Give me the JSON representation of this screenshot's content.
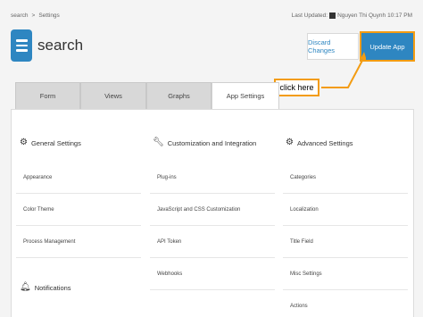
{
  "breadcrumb": {
    "root": "search",
    "separator": ">",
    "current": "Settings"
  },
  "header": {
    "last_updated_label": "Last Updated:",
    "user": "Nguyen Thi Quynh",
    "time": "10:17 PM",
    "app_name": "search"
  },
  "actions": {
    "discard": "Discard Changes",
    "update": "Update App"
  },
  "callout": {
    "text": "click here"
  },
  "tabs": [
    {
      "label": "Form"
    },
    {
      "label": "Views"
    },
    {
      "label": "Graphs"
    },
    {
      "label": "App Settings"
    }
  ],
  "columns": {
    "general": {
      "title": "General Settings",
      "icon": "gear-icon",
      "items": [
        "Appearance",
        "Color Theme",
        "Process Management"
      ]
    },
    "customization": {
      "title": "Customization and Integration",
      "icon": "wrench-icon",
      "items": [
        "Plug-ins",
        "JavaScript and CSS Customization",
        "API Token",
        "Webhooks"
      ]
    },
    "advanced": {
      "title": "Advanced Settings",
      "icon": "gears-icon",
      "items": [
        "Categories",
        "Localization",
        "Title Field",
        "Misc Settings",
        "Actions"
      ]
    },
    "notifications": {
      "title": "Notifications",
      "icon": "bell-icon"
    }
  },
  "colors": {
    "accent": "#2e86c1",
    "highlight": "#f39c12"
  }
}
